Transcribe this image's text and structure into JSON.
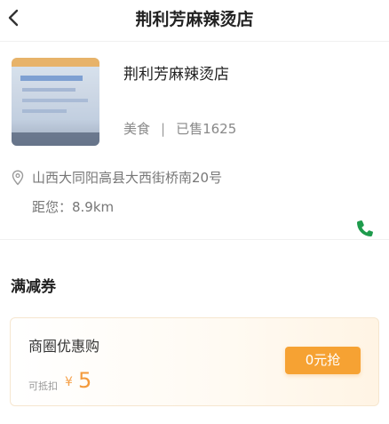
{
  "header": {
    "back_icon": "chevron-left-icon",
    "title": "荆利芳麻辣烫店"
  },
  "store": {
    "name": "荆利芳麻辣烫店",
    "category": "美食",
    "separator": "|",
    "sold": "已售1625",
    "address": "山西大同阳高县大西街桥南20号",
    "distance": "距您：8.9km",
    "pin_icon": "location-pin-icon",
    "phone_icon": "phone-icon",
    "accent_color": "#1e9b4c"
  },
  "coupons": {
    "section_title": "满减券",
    "items": [
      {
        "name": "商圈优惠购",
        "value_label": "可抵扣",
        "currency": "¥",
        "amount": "5",
        "button_label": "0元抢"
      }
    ],
    "accent_color": "#f6a233"
  }
}
